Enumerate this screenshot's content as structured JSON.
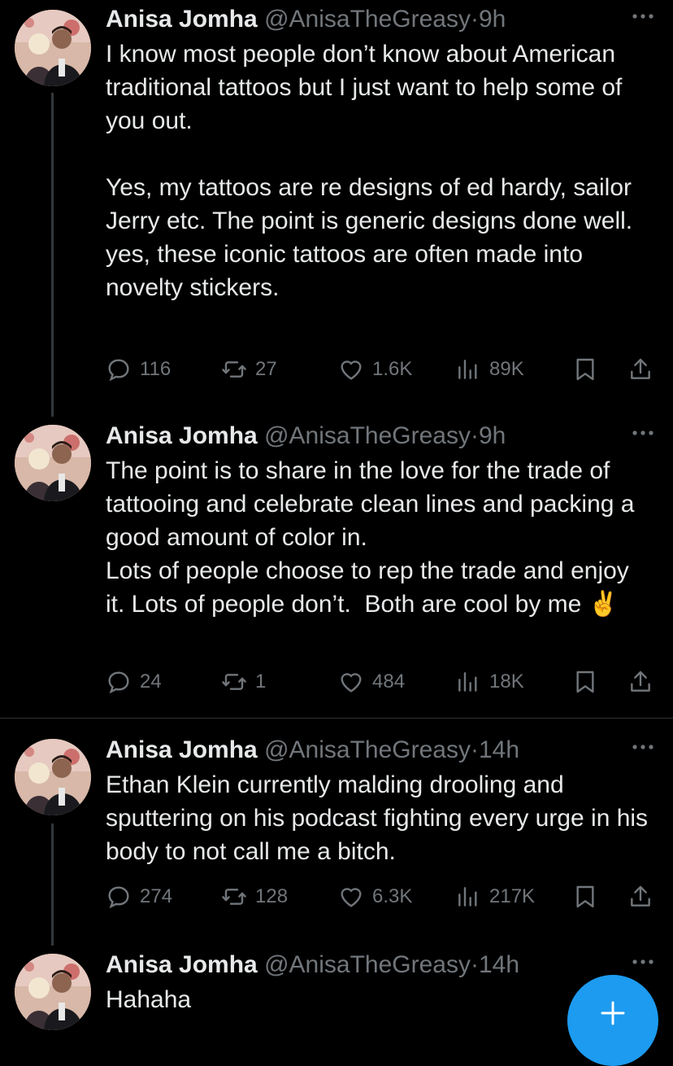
{
  "tweets": [
    {
      "name": "Anisa Jomha",
      "handle": "@AnisaTheGreasy",
      "separator": "·",
      "time": "9h",
      "text": "I know most people don’t know about American traditional tattoos but I just want to help some of you out.\n\nYes, my tattoos are re designs of ed hardy, sailor Jerry etc. The point is generic designs done well.\nyes, these iconic tattoos are often made into novelty stickers.",
      "replies": "116",
      "reposts": "27",
      "likes": "1.6K",
      "views": "89K"
    },
    {
      "name": "Anisa Jomha",
      "handle": "@AnisaTheGreasy",
      "separator": "·",
      "time": "9h",
      "text": "The point is to share in the love for the trade of tattooing and celebrate clean lines and packing a good amount of color in.\nLots of people choose to rep the trade and enjoy it. Lots of people don’t.  Both are cool by me ✌️",
      "replies": "24",
      "reposts": "1",
      "likes": "484",
      "views": "18K"
    },
    {
      "name": "Anisa Jomha",
      "handle": "@AnisaTheGreasy",
      "separator": "·",
      "time": "14h",
      "text": "Ethan Klein currently malding drooling and sputtering on his podcast fighting every urge in his body to not call me a bitch.",
      "replies": "274",
      "reposts": "128",
      "likes": "6.3K",
      "views": "217K"
    },
    {
      "name": "Anisa Jomha",
      "handle": "@AnisaTheGreasy",
      "separator": "·",
      "time": "14h",
      "text": "Hahaha"
    }
  ],
  "icons": {
    "reply": "reply-icon",
    "repost": "repost-icon",
    "like": "heart-icon",
    "views": "views-icon",
    "bookmark": "bookmark-icon",
    "share": "share-icon",
    "more": "more-icon",
    "compose": "plus-icon"
  },
  "colors": {
    "background": "#000000",
    "text": "#e7e9ea",
    "muted": "#71767b",
    "accent": "#1d9bf0"
  }
}
